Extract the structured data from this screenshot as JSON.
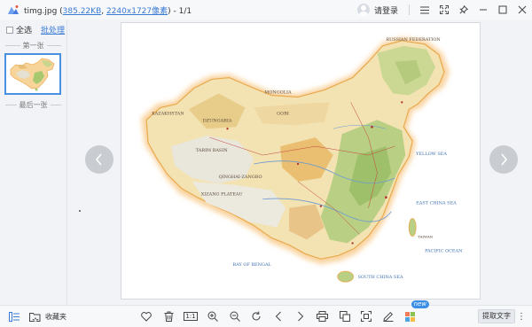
{
  "titlebar": {
    "app_icon": "image-viewer-logo-icon",
    "filename": "timg.jpg",
    "open_paren": " (",
    "size_link": "385.22KB",
    "comma": ", ",
    "dim_link": "2240x1727像素",
    "close_paren": ")",
    "position": " - 1/1",
    "login_label": "请登录",
    "buttons": [
      "menu-icon",
      "fullscreen-icon",
      "pin-icon",
      "minimize-icon",
      "maximize-icon",
      "close-icon"
    ]
  },
  "sidebar": {
    "select_all": "全选",
    "batch_process": "批处理",
    "first_label": "第一张",
    "last_label": "最后一张",
    "thumbnail_count": 1,
    "selected_index": 0
  },
  "viewer": {
    "prev_icon": "chevron-left-icon",
    "next_icon": "chevron-right-icon",
    "map_labels": {
      "mongolia": "MONGOLIA",
      "russian_fed": "RUSSIAN FEDERATION",
      "kazakhstan": "KAZAKHSTAN",
      "tarim": "TARIM BASIN",
      "dzungaria": "DZUNGARIA",
      "qinghai": "QINGHAI-ZANGBO",
      "xizang": "XIZANG PLATEAU",
      "gobi": "GOBI",
      "yellow_sea": "YELLOW SEA",
      "east_china_sea": "EAST CHINA SEA",
      "south_china_sea": "SOUTH CHINA SEA",
      "pacific": "PACIFIC OCEAN",
      "taiwan": "TAIWAN",
      "bay_of_bengal": "BAY OF BENGAL"
    }
  },
  "bottombar": {
    "left_icons": [
      "thumbnail-panel-icon",
      "favorites-folder-icon"
    ],
    "favorites_label": "收藏夹",
    "tools": [
      "heart-icon",
      "trash-icon",
      "actual-size-icon",
      "zoom-in-icon",
      "zoom-out-icon",
      "rotate-icon",
      "prev-arrow-icon",
      "next-arrow-icon",
      "print-icon",
      "copy-icon",
      "crop-icon",
      "edit-icon",
      "apps-icon"
    ],
    "actual_size_label": "1:1",
    "new_badge": "new",
    "extract_text": "提取文字",
    "more_icon": "more-vertical-icon"
  },
  "colors": {
    "accent": "#3a7bd5",
    "badge": "#3a8ee6",
    "arrow_bg": "#c9ccd1"
  }
}
